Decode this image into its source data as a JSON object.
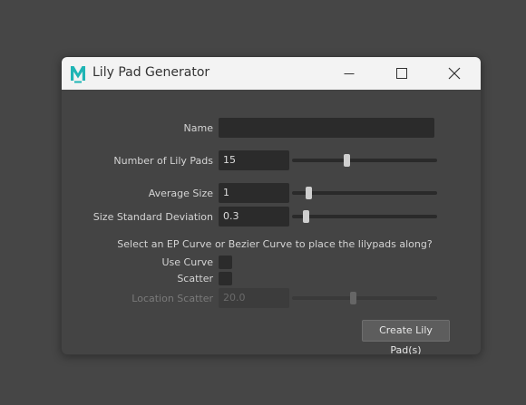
{
  "window": {
    "title": "Lily Pad Generator",
    "app_icon": "maya-m-icon"
  },
  "form": {
    "name": {
      "label": "Name",
      "value": ""
    },
    "num_pads": {
      "label": "Number of Lily Pads",
      "value": "15",
      "slider_level": 0.37
    },
    "avg_size": {
      "label": "Average Size",
      "value": "1",
      "slider_level": 0.1
    },
    "size_std": {
      "label": "Size Standard Deviation",
      "value": "0.3",
      "slider_level": 0.08
    },
    "hint": "Select an EP Curve or Bezier Curve to place the lilypads along?",
    "use_curve": {
      "label": "Use Curve",
      "checked": false
    },
    "scatter": {
      "label": "Scatter",
      "checked": false
    },
    "location_scatter": {
      "label": "Location Scatter",
      "value": "20.0",
      "slider_level": 0.42,
      "enabled": false
    },
    "create_label": "Create Lily Pad(s)"
  },
  "colors": {
    "window_bg": "#444444",
    "titlebar_bg": "#f3f3f3",
    "field_bg": "#2b2b2b",
    "maya_teal": "#1fb5b5"
  }
}
